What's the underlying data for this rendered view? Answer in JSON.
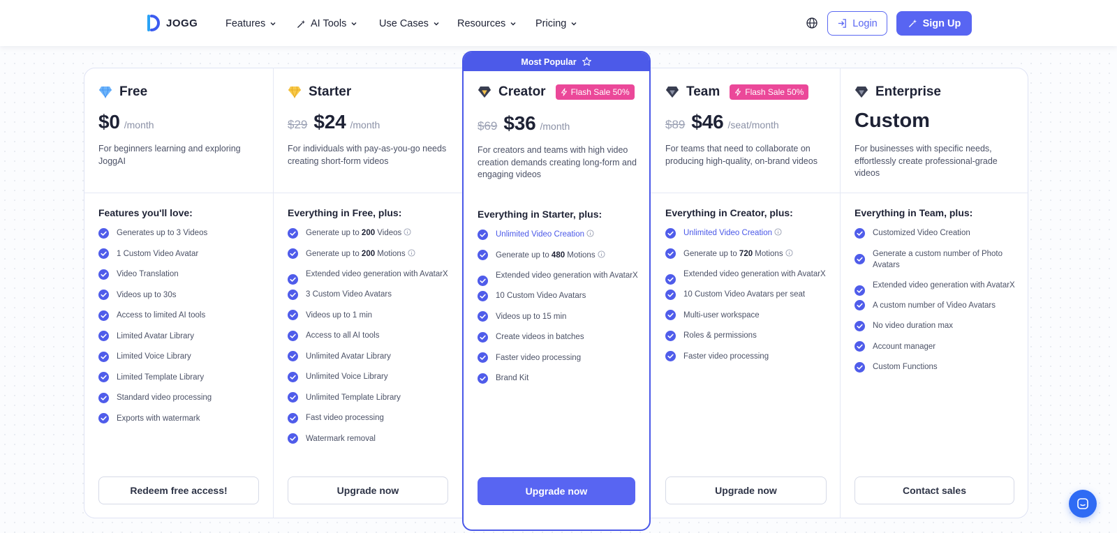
{
  "nav": {
    "logo_text": "JOGG",
    "items": [
      {
        "label": "Features",
        "icon": "chevron-down-icon"
      },
      {
        "label": "AI Tools",
        "icon": "sparkle-icon"
      },
      {
        "label": "Use Cases",
        "icon": "chevron-down-icon"
      },
      {
        "label": "Resources",
        "icon": "chevron-down-icon"
      },
      {
        "label": "Pricing",
        "icon": "chevron-down-icon"
      }
    ],
    "login_label": "Login",
    "signup_label": "Sign Up"
  },
  "colors": {
    "accent": "#5865f2",
    "flash_badge": "#eb4899",
    "text_primary": "#1e2235",
    "text_secondary": "#4b5166"
  },
  "plans": [
    {
      "name": "Free",
      "icon": "diamond-blue-icon",
      "old_price": "",
      "price": "$0",
      "per": "/month",
      "description": "For beginners learning and exploring JoggAI",
      "features_title": "Features you'll love:",
      "features": [
        "Generates up to 3 Videos",
        "1 Custom Video Avatar",
        "Video Translation",
        "Videos up to 30s",
        "Access to limited AI tools",
        "Limited Avatar Library",
        "Limited Voice Library",
        "Limited Template Library",
        "Standard video processing",
        "Exports with watermark"
      ],
      "cta": "Redeem free access!"
    },
    {
      "name": "Starter",
      "icon": "diamond-gold-icon",
      "old_price": "$29",
      "price": "$24",
      "per": "/month",
      "description": "For individuals with pay-as-you-go needs creating short-form videos",
      "features_title": "Everything in Free, plus:",
      "features": [
        {
          "pre": "Generate up to ",
          "bold": "200",
          "post": " Videos",
          "info": true
        },
        {
          "pre": "Generate up to ",
          "bold": "200",
          "post": " Motions",
          "info": true
        },
        "Extended video generation with AvatarX",
        "3 Custom Video Avatars",
        "Videos up to 1 min",
        "Access to all AI tools",
        "Unlimited Avatar Library",
        "Unlimited Voice Library",
        "Unlimited Template Library",
        "Fast video processing",
        "Watermark removal"
      ],
      "cta": "Upgrade now"
    },
    {
      "name": "Creator",
      "icon": "diamond-dark-gold-icon",
      "banner": "Most Popular",
      "flash": "Flash Sale 50%",
      "old_price": "$69",
      "price": "$36",
      "per": "/month",
      "description": "For creators and teams with high video creation demands creating long-form and engaging videos",
      "features_title": "Everything in Starter, plus:",
      "features": [
        {
          "pre": "Unlimited Video Creation",
          "bold": "",
          "post": "",
          "info": true,
          "highlight": true
        },
        {
          "pre": "Generate up to ",
          "bold": "480",
          "post": " Motions",
          "info": true
        },
        "Extended video generation with AvatarX",
        "10 Custom Video Avatars",
        "Videos up to 15 min",
        "Create videos in batches",
        "Faster video processing",
        "Brand Kit"
      ],
      "cta": "Upgrade now"
    },
    {
      "name": "Team",
      "icon": "diamond-dark-icon",
      "flash": "Flash Sale 50%",
      "old_price": "$89",
      "price": "$46",
      "per": "/seat/month",
      "description": "For teams that need to collaborate on producing high-quality, on-brand videos",
      "features_title": "Everything in Creator, plus:",
      "features": [
        {
          "pre": "Unlimited Video Creation",
          "bold": "",
          "post": "",
          "info": true,
          "highlight": true
        },
        {
          "pre": "Generate up to ",
          "bold": "720",
          "post": " Motions",
          "info": true
        },
        "Extended video generation with AvatarX",
        "10 Custom Video Avatars per seat",
        "Multi-user workspace",
        "Roles & permissions",
        "Faster video processing"
      ],
      "cta": "Upgrade now"
    },
    {
      "name": "Enterprise",
      "icon": "diamond-dark-icon",
      "old_price": "",
      "price": "Custom",
      "per": "",
      "description": "For businesses with specific needs, effortlessly create professional-grade videos",
      "features_title": "Everything in Team, plus:",
      "features": [
        "Customized Video Creation",
        "Generate a custom number of Photo Avatars",
        "Extended video generation with AvatarX",
        "A custom number of Video Avatars",
        "No video duration max",
        "Account manager",
        "Custom Functions"
      ],
      "cta": "Contact sales"
    }
  ]
}
